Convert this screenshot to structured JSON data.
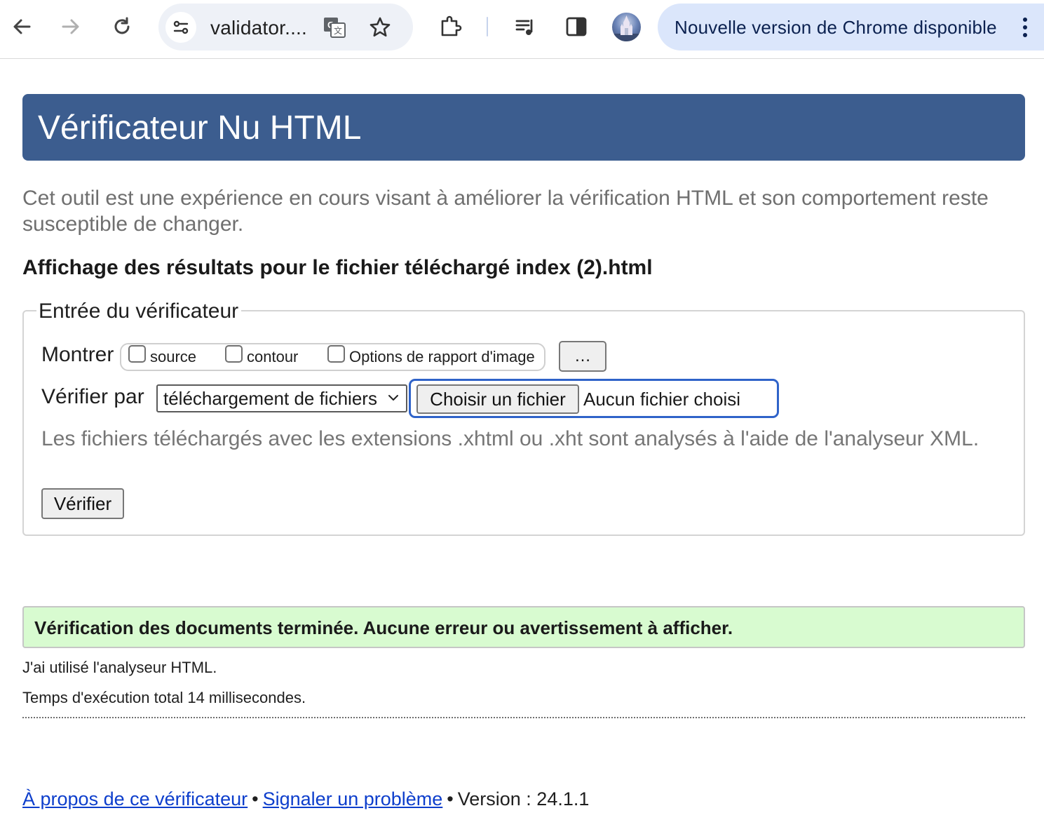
{
  "browser": {
    "url_display": "validator....",
    "update_notice": "Nouvelle version de Chrome disponible",
    "icons": {
      "back": "arrow-left-icon",
      "forward": "arrow-right-icon",
      "reload": "reload-icon",
      "site_info": "tune-icon",
      "translate": "translate-icon",
      "bookmark": "star-icon",
      "extensions": "puzzle-icon",
      "media": "media-queue-icon",
      "side_panel": "side-panel-icon",
      "profile": "avatar",
      "menu": "kebab-menu-icon"
    }
  },
  "page": {
    "heading": "Vérificateur Nu HTML",
    "intro": "Cet outil est une expérience en cours visant à améliorer la vérification HTML et son comportement reste susceptible de changer.",
    "results_title": "Affichage des résultats pour le fichier téléchargé index (2).html"
  },
  "form": {
    "legend": "Entrée du vérificateur",
    "show_label": "Montrer",
    "options": [
      {
        "label": "source",
        "checked": false
      },
      {
        "label": "contour",
        "checked": false
      },
      {
        "label": "Options de rapport d'image",
        "checked": false
      }
    ],
    "more_button": "…",
    "check_by_label": "Vérifier par",
    "check_by_selected": "téléchargement de fichiers",
    "choose_file_button": "Choisir un fichier",
    "file_status": "Aucun fichier choisi",
    "hint": "Les fichiers téléchargés avec les extensions .xhtml ou .xht sont analysés à l'aide de l'analyseur XML.",
    "verify_button": "Vérifier"
  },
  "results": {
    "success_message": "Vérification des documents terminée. Aucune erreur ou avertissement à afficher.",
    "parser_line": "J'ai utilisé l'analyseur HTML.",
    "timing_line": "Temps d'exécution total 14 millisecondes."
  },
  "footer": {
    "about_link": "À propos de ce vérificateur",
    "separator": "•",
    "report_link": "Signaler un problème",
    "version": "Version : 24.1.1"
  },
  "colors": {
    "header_bg": "#3c5d8f",
    "success_bg": "#d8fbd0",
    "link": "#0d3ecc",
    "focus_ring": "#2f63c9",
    "update_pill": "#dbe6fb"
  }
}
